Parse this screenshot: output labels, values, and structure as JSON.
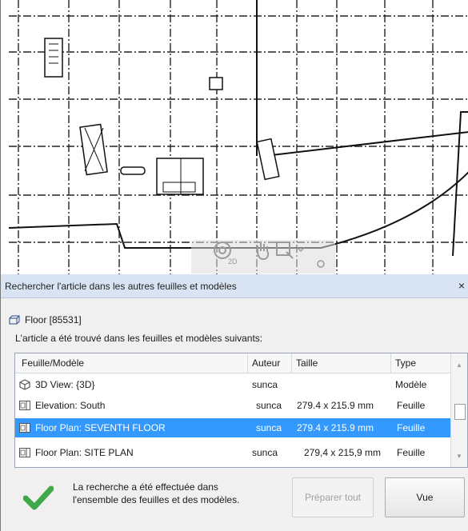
{
  "dialog": {
    "title": "Rechercher l'article dans les autres feuilles et modèles",
    "close_glyph": "×",
    "element_name": "Floor [85531]",
    "found_message": "L'article a été trouvé dans les feuilles et modèles suivants:",
    "columns": [
      "Feuille/Modèle",
      "Auteur",
      "Taille",
      "Type"
    ],
    "rows": [
      {
        "name": "3D View: {3D}",
        "author": "sunca",
        "size": "",
        "type": "Modèle",
        "icon": "3d-view-icon",
        "selected": false
      },
      {
        "name": "Elevation: South",
        "author": "sunca",
        "size": "279.4 x 215.9 mm",
        "type": "Feuille",
        "icon": "sheet-icon",
        "selected": false
      },
      {
        "name": "Floor Plan: SEVENTH FLOOR",
        "author": "sunca",
        "size": "279.4 x 215.9 mm",
        "type": "Feuille",
        "icon": "sheet-icon",
        "selected": true
      },
      {
        "name": "Floor Plan: SITE PLAN",
        "author": "sunca",
        "size": "279,4 x 215,9 mm",
        "type": "Feuille",
        "icon": "sheet-icon",
        "selected": false
      }
    ],
    "status_line1": "La recherche a été effectuée dans",
    "status_line2": "l'ensemble des feuilles et des modèles.",
    "prepare_all_label": "Préparer tout",
    "view_label": "Vue"
  },
  "colors": {
    "selection": "#3399ff",
    "check": "#3fa84a",
    "titlebar": "#d8e4f3"
  },
  "canvas_overlay": {
    "zoom_icon_text": "2D"
  }
}
